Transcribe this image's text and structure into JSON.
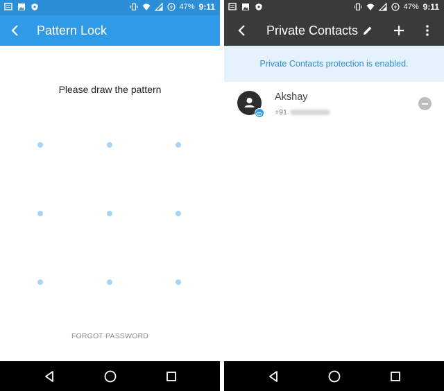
{
  "left_screen": {
    "status_bar": {
      "battery_text": "47%",
      "time": "9:11"
    },
    "app_bar": {
      "title": "Pattern Lock"
    },
    "prompt": "Please draw the pattern",
    "forgot_password": "FORGOT PASSWORD",
    "pattern_dots": 9,
    "accent_color": "#2f9be8"
  },
  "right_screen": {
    "status_bar": {
      "battery_text": "47%",
      "time": "9:11"
    },
    "app_bar": {
      "title": "Private Contacts"
    },
    "banner": "Private Contacts protection is enabled.",
    "contacts": [
      {
        "name": "Akshay",
        "number_prefix": "+91"
      }
    ],
    "toolbar_color": "#3a3a3a"
  },
  "icons": {
    "status_left": [
      "message-icon",
      "image-icon",
      "shield-icon"
    ],
    "status_right": [
      "vibrate-icon",
      "wifi-icon",
      "signal-icon",
      "battery-icon"
    ],
    "app_bar_right": [
      "edit-icon",
      "add-icon",
      "more-vert-icon"
    ],
    "nav": [
      "back-icon",
      "home-icon",
      "recents-icon"
    ]
  }
}
